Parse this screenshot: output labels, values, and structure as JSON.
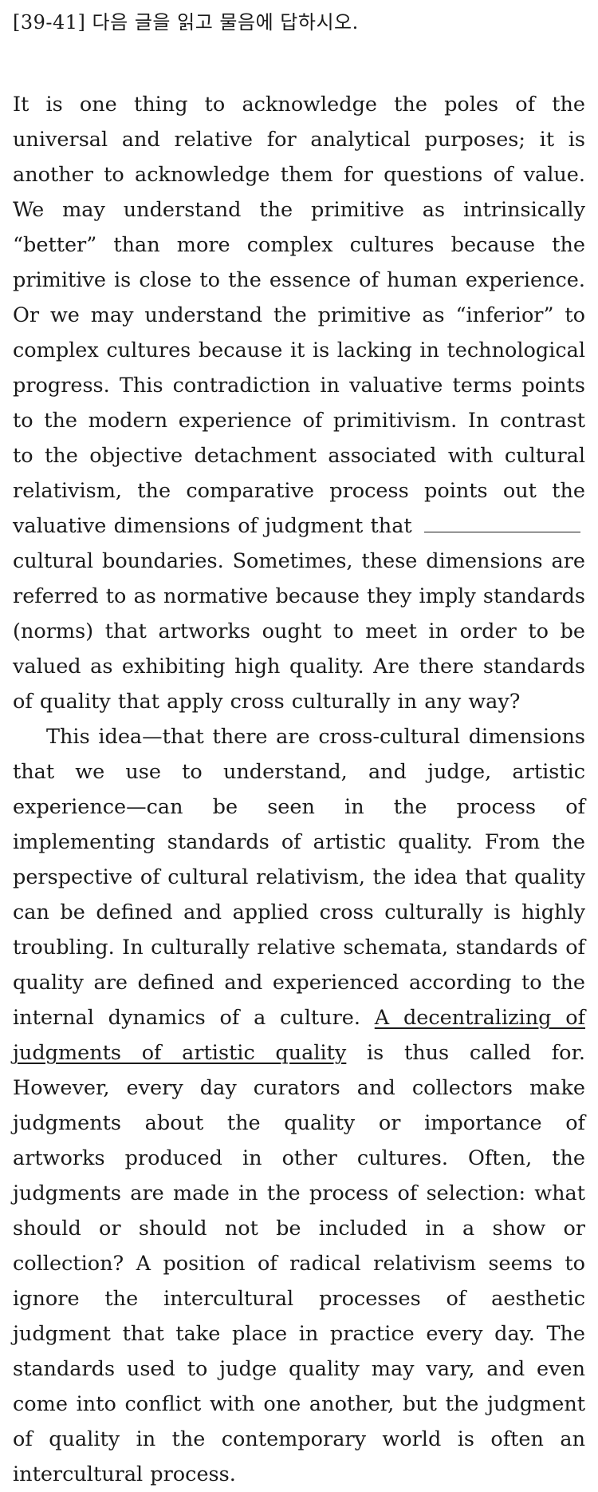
{
  "header": {
    "instruction": "[39-41] 다음 글을 읽고 물음에 답하시오."
  },
  "passage": {
    "p1": {
      "text_before_blank": "It is one thing to acknowledge the poles of the universal and relative for analytical purposes; it is another to acknowledge them for questions of value. We may understand the primitive as intrinsically “better” than more complex cultures because the primitive is close to the essence of human experience. Or we may understand the primitive as “inferior” to complex cultures because it is lacking in technological progress. This contradiction in valuative terms points to the modern experience of primitivism. In contrast to the objective detachment associated with cultural relativism, the comparative process points out the valuative dimensions of judgment that",
      "text_after_blank": "cultural boundaries. Sometimes, these dimensions are referred to as normative because they imply standards (norms) that artworks ought to meet in order to be valued as exhibiting high quality. Are there standards of quality that apply cross culturally in any way?"
    },
    "p2": {
      "text_before_underline": "This idea—that there are cross-cultural dimensions that we use to understand, and judge, artistic experience—can be seen in the process of implementing standards of artistic quality. From the perspective of cultural relativism, the idea that quality can be defined and applied cross culturally is highly troubling. In culturally relative schemata, standards of quality are defined and experienced according to the internal dynamics of a culture.",
      "underlined_phrase": "A decentralizing of judgments of artistic quality",
      "text_after_underline": "is thus called for. However, every day curators and collectors make judgments about the quality or importance of artworks produced in other cultures. Often, the judgments are made in the process of selection: what should or should not be included in a show or collection? A position of radical relativism seems to ignore the intercultural processes of aesthetic judgment that take place in practice every day. The standards used to judge quality may vary, and even come into conflict with one another, but the judgment of quality in the contemporary world is often an intercultural process."
    }
  }
}
